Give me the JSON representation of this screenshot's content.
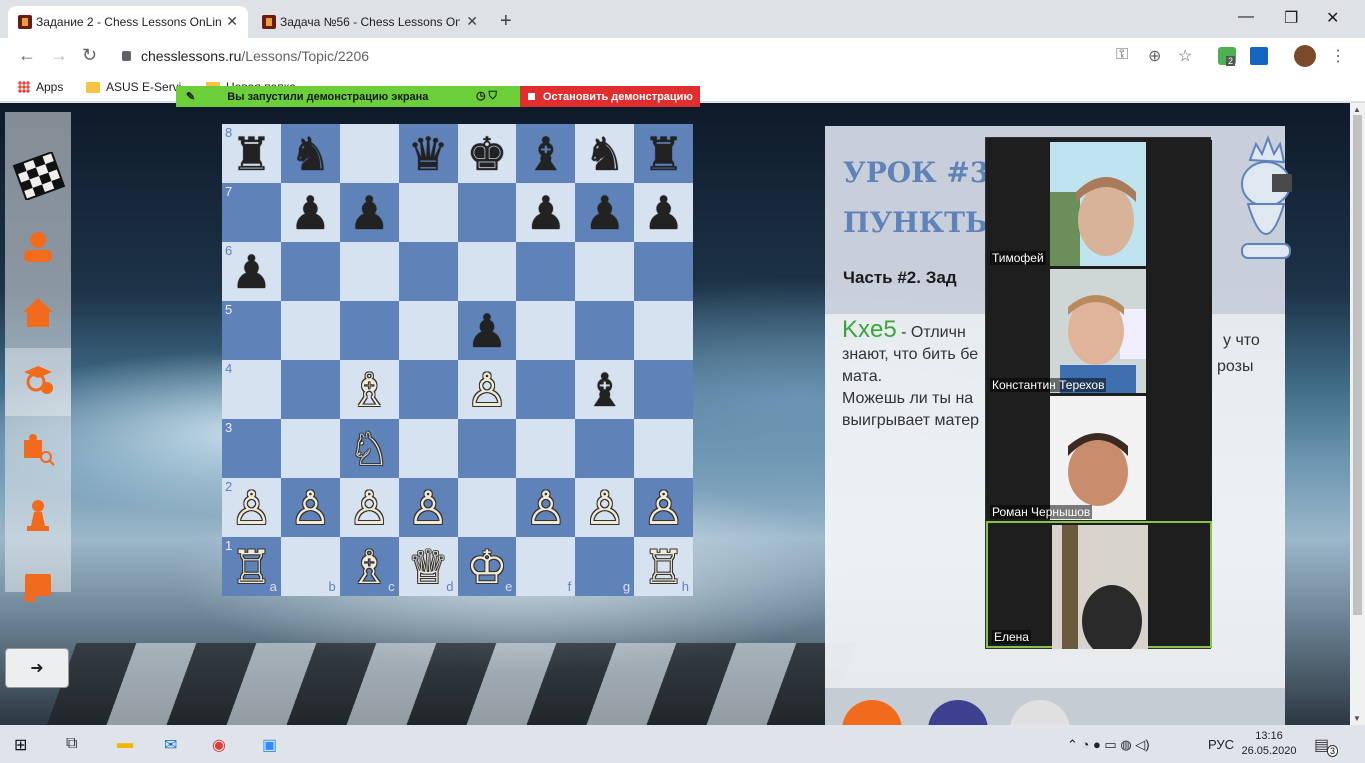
{
  "browser": {
    "tabs": [
      {
        "title": "Задание 2 - Chess Lessons OnLin",
        "active": true
      },
      {
        "title": "Задача №56 - Chess Lessons On",
        "active": false
      }
    ],
    "url_domain": "chesslessons.ru",
    "url_path": "/Lessons/Topic/2206",
    "extension_badge": "2"
  },
  "bookmarks": [
    {
      "label": "Apps"
    },
    {
      "label": "ASUS E-Servi"
    },
    {
      "label": "Новая папка"
    }
  ],
  "share_banner": {
    "message": "Вы запустили демонстрацию экрана",
    "stop_label": "Остановить демонстрацию"
  },
  "sidebar": {
    "items": [
      "chessboard-icon",
      "user-icon",
      "home-icon",
      "student-icon",
      "puzzle-search-icon",
      "pawn-icon",
      "book-icon"
    ],
    "logout_icon": "logout-icon"
  },
  "board": {
    "ranks": [
      "8",
      "7",
      "6",
      "5",
      "4",
      "3",
      "2",
      "1"
    ],
    "files": [
      "a",
      "b",
      "c",
      "d",
      "e",
      "f",
      "g",
      "h"
    ],
    "position": [
      [
        "♜",
        "♞",
        "",
        "♛",
        "♚",
        "♝",
        "♞",
        "♜"
      ],
      [
        "",
        "♟",
        "♟",
        "",
        "",
        "♟",
        "♟",
        "♟"
      ],
      [
        "♟",
        "",
        "",
        "",
        "",
        "",
        "",
        ""
      ],
      [
        "",
        "",
        "",
        "",
        "♟",
        "",
        "",
        ""
      ],
      [
        "",
        "",
        "♗",
        "",
        "♙",
        "",
        "♝",
        ""
      ],
      [
        "",
        "",
        "♘",
        "",
        "",
        "",
        "",
        ""
      ],
      [
        "♙",
        "♙",
        "♙",
        "♙",
        "",
        "♙",
        "♙",
        "♙"
      ],
      [
        "♖",
        "",
        "♗",
        "♕",
        "♔",
        "",
        "",
        "♖"
      ]
    ],
    "colors": {
      "light": "#d6e2f0",
      "dark": "#5f82b9"
    }
  },
  "lesson": {
    "title_line1": "УРОК #3",
    "title_line2": "ПУНКТЫ",
    "subtitle": "Часть #2. Зад",
    "move": "Kxe5",
    "text_line1": " - Отличн",
    "text_tail1": "у что",
    "text_line2": "знают, что бить бе",
    "text_tail2": "розы",
    "text_line3": "мата.",
    "text_line4": "Можешь ли ты на",
    "text_line5": "выигрывает матер",
    "accent_color": "#3ea33a"
  },
  "video": {
    "participants": [
      {
        "name": "Тимофей"
      },
      {
        "name": "Константин Терехов"
      },
      {
        "name": "Роман Чернышов"
      },
      {
        "name": "Елена",
        "active": true
      }
    ]
  },
  "taskbar": {
    "language": "РУС",
    "time": "13:16",
    "date": "26.05.2020",
    "notifications": "3"
  }
}
